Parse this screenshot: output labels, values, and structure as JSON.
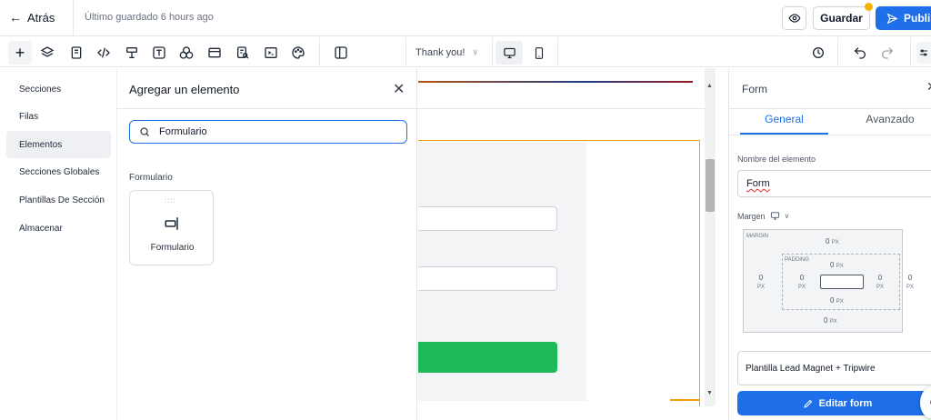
{
  "topbar": {
    "back_label": "Atrás",
    "saved_text": "Último guardado 6 hours ago",
    "save_label": "Guardar",
    "publish_label": "Publis"
  },
  "toolbar": {
    "icons": [
      "plus-icon",
      "layers-icon",
      "page-icon",
      "code-icon",
      "section-icon",
      "text-icon",
      "shapes-icon",
      "window-icon",
      "form-search-icon",
      "terminal-icon",
      "palette-icon",
      "columns-icon"
    ],
    "page_select": "Thank you!",
    "view_desktop": "desktop-icon",
    "view_mobile": "mobile-icon"
  },
  "leftnav": {
    "items": [
      {
        "label": "Secciones",
        "active": false
      },
      {
        "label": "Filas",
        "active": false
      },
      {
        "label": "Elementos",
        "active": true
      },
      {
        "label": "Secciones Globales",
        "active": false
      },
      {
        "label": "Plantillas De Sección",
        "active": false
      },
      {
        "label": "Almacenar",
        "active": false
      }
    ]
  },
  "add_panel": {
    "title": "Agregar un elemento",
    "search_value": "Formulario",
    "category": "Formulario",
    "card_label": "Formulario"
  },
  "right_panel": {
    "title": "Form",
    "tab_general": "General",
    "tab_advanced": "Avanzado",
    "name_label": "Nombre del elemento",
    "name_value": "Form",
    "margin_label": "Margen",
    "spacing": {
      "margin_label": "MARGIN",
      "padding_label": "PADDING",
      "margin_top": "0",
      "margin_bottom": "0",
      "margin_left": "0",
      "margin_right": "0",
      "padding_top": "0",
      "padding_bottom": "0",
      "padding_left": "0",
      "padding_right": "0",
      "unit": "PX"
    },
    "template_value": "Plantilla Lead Magnet + Tripwire",
    "edit_button": "Editar form"
  },
  "colors": {
    "accent": "#1f6feb",
    "submit_green": "#1fba58",
    "section_outline": "#f59e0b",
    "notification": "#f5b301"
  }
}
